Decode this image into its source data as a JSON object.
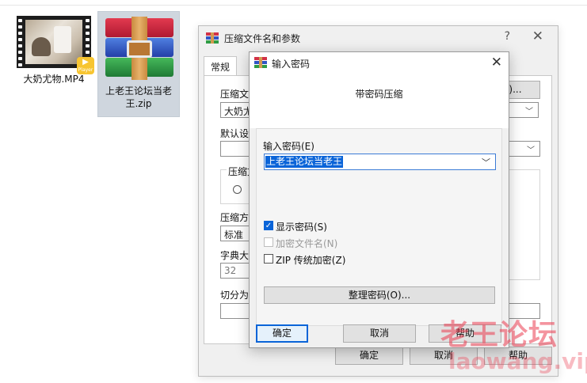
{
  "desktop": {
    "files": [
      {
        "name": "大奶尤物.MP4",
        "icon": "video-file-icon",
        "badge": "Player"
      },
      {
        "name": "上老王论坛当老王.zip",
        "icon": "winrar-archive-icon"
      }
    ]
  },
  "main_dialog": {
    "title": "压缩文件名和参数",
    "help": "?",
    "close": "✕",
    "tab_general": "常规",
    "label_archive_name": "压缩文",
    "archive_name_value": "大奶尤",
    "browse_label": "(B)...",
    "label_default": "默认设",
    "label_format": "压缩文",
    "label_method": "压缩方",
    "method_value": "标准",
    "label_dict": "字典大",
    "dict_value": "32",
    "label_split": "切分为",
    "ok": "确定",
    "cancel": "取消",
    "help_btn": "帮助"
  },
  "password_dialog": {
    "title": "输入密码",
    "close": "✕",
    "header": "带密码压缩",
    "label_password": "输入密码(E)",
    "password_value": "上老王论坛当老王",
    "show_password": "显示密码(S)",
    "encrypt_names": "加密文件名(N)",
    "zip_legacy": "ZIP 传统加密(Z)",
    "manage_button": "整理密码(O)...",
    "ok": "确定",
    "cancel": "取消",
    "help": "帮助",
    "checked_mark": "✓"
  },
  "watermark": {
    "text": "老王论坛",
    "url": "laowang.vip"
  }
}
